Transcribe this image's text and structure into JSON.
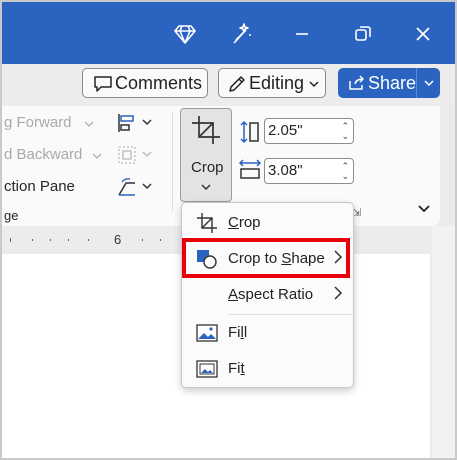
{
  "titlebar": {
    "icons": [
      "diamond-icon",
      "magic-wand-icon",
      "minimize-icon",
      "restore-icon",
      "close-icon"
    ]
  },
  "header": {
    "comments_label": "Comments",
    "editing_label": "Editing",
    "share_label": "Share"
  },
  "ribbon": {
    "arrange": {
      "bring_forward": "g Forward",
      "send_backward": "d Backward",
      "selection_pane": "ction Pane",
      "group_label": "ge"
    },
    "crop_button_label": "Crop",
    "height_value": "2.05\"",
    "width_value": "3.08\""
  },
  "ruler": {
    "mark": "6"
  },
  "crop_menu": {
    "items": [
      {
        "label_pre": "",
        "label_u": "C",
        "label_post": "rop",
        "icon": "crop-icon"
      },
      {
        "label_pre": "Crop to ",
        "label_u": "S",
        "label_post": "hape",
        "icon": "crop-to-shape-icon",
        "submenu": true
      },
      {
        "label_pre": "",
        "label_u": "A",
        "label_post": "spect Ratio",
        "icon": "",
        "submenu": true
      },
      {
        "label_pre": "Fi",
        "label_u": "l",
        "label_post": "l",
        "icon": "fill-picture-icon"
      },
      {
        "label_pre": "Fi",
        "label_u": "t",
        "label_post": "",
        "icon": "fit-picture-icon"
      }
    ]
  },
  "colors": {
    "titlebar": "#2b63c1",
    "highlight": "#e8000d"
  }
}
